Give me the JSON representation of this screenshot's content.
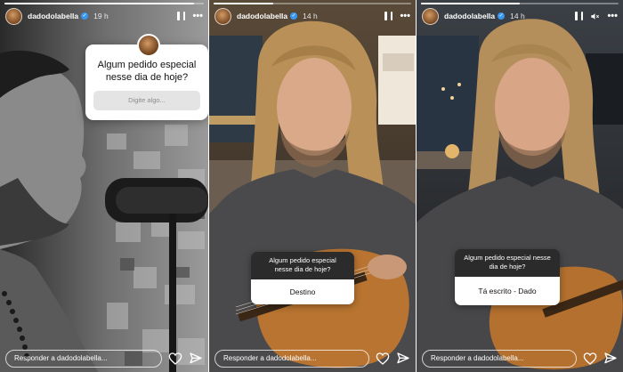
{
  "stories": [
    {
      "username": "dadodolabella",
      "time": "19 h",
      "progress_fraction": 0.95,
      "question": "Algum pedido especial nesse dia de hoje?",
      "input_placeholder": "Digite algo...",
      "reply_placeholder": "Responder a dadodolabella..."
    },
    {
      "username": "dadodolabella",
      "time": "14 h",
      "progress_fraction": 0.3,
      "question": "Algum pedido especial nesse dia de hoje?",
      "answer": "Destino",
      "reply_placeholder": "Responder a dadodolabella..."
    },
    {
      "username": "dadodolabella",
      "time": "14 h",
      "progress_fraction": 0.5,
      "question": "Algum pedido especial nesse dia de hoje?",
      "answer": "Tá escrito - Dado",
      "reply_placeholder": "Responder a dadodolabella..."
    }
  ],
  "icons": {
    "pause": "pause-icon",
    "mute": "speaker-muted-icon",
    "more": "more-icon",
    "like": "heart-icon",
    "share": "send-icon",
    "verified": "verified-badge-icon"
  },
  "colors": {
    "verified": "#3897f0",
    "sticker_dark": "#2b2b2b",
    "sticker_input": "#e4e4e4"
  }
}
